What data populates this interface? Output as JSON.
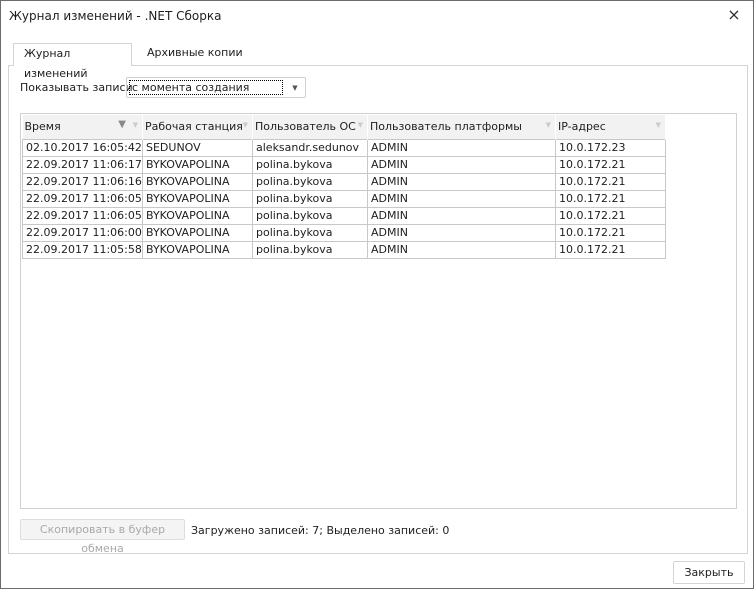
{
  "window": {
    "title": "Журнал изменений - .NET Сборка",
    "close_icon": "×"
  },
  "tabs": [
    {
      "label": "Журнал изменений",
      "active": true
    },
    {
      "label": "Архивные копии",
      "active": false
    }
  ],
  "filter": {
    "label": "Показывать записи",
    "value": "с момента создания"
  },
  "grid": {
    "columns": [
      "Время",
      "Рабочая станция",
      "Пользователь ОС",
      "Пользователь платформы",
      "IP-адрес"
    ],
    "rows": [
      [
        "02.10.2017 16:05:42",
        "SEDUNOV",
        "aleksandr.sedunov",
        "ADMIN",
        "10.0.172.23"
      ],
      [
        "22.09.2017 11:06:17",
        "BYKOVAPOLINA",
        "polina.bykova",
        "ADMIN",
        "10.0.172.21"
      ],
      [
        "22.09.2017 11:06:16",
        "BYKOVAPOLINA",
        "polina.bykova",
        "ADMIN",
        "10.0.172.21"
      ],
      [
        "22.09.2017 11:06:05",
        "BYKOVAPOLINA",
        "polina.bykova",
        "ADMIN",
        "10.0.172.21"
      ],
      [
        "22.09.2017 11:06:05",
        "BYKOVAPOLINA",
        "polina.bykova",
        "ADMIN",
        "10.0.172.21"
      ],
      [
        "22.09.2017 11:06:00",
        "BYKOVAPOLINA",
        "polina.bykova",
        "ADMIN",
        "10.0.172.21"
      ],
      [
        "22.09.2017 11:05:58",
        "BYKOVAPOLINA",
        "polina.bykova",
        "ADMIN",
        "10.0.172.21"
      ]
    ]
  },
  "footer": {
    "copy_label": "Скопировать в буфер обмена",
    "status": "Загружено записей: 7; Выделено записей: 0",
    "close_label": "Закрыть"
  }
}
